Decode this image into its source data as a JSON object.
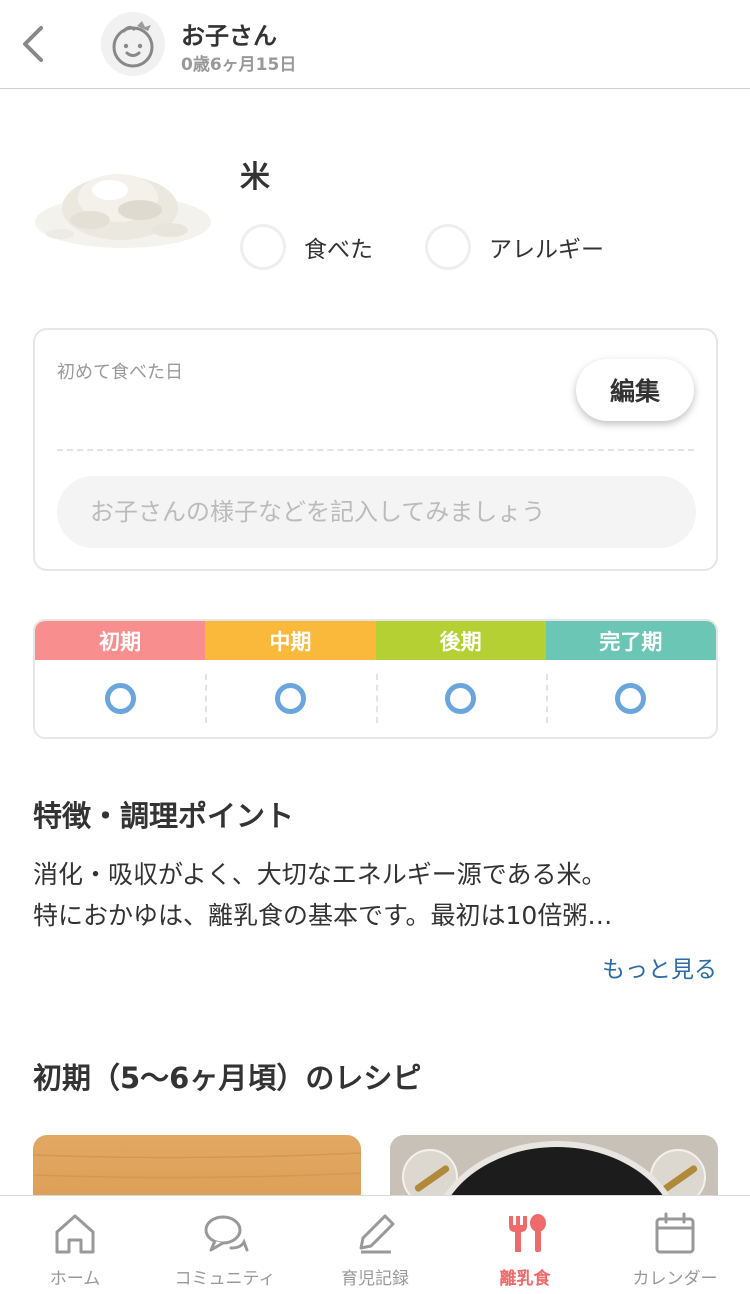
{
  "header": {
    "child_name": "お子さん",
    "child_age": "0歳6ヶ月15日"
  },
  "food": {
    "name": "米",
    "eaten_label": "食べた",
    "allergy_label": "アレルギー",
    "eaten_checked": false,
    "allergy_checked": false
  },
  "first_eaten": {
    "title": "初めて食べた日",
    "edit_label": "編集",
    "memo_value": "",
    "memo_placeholder": "お子さんの様子などを記入してみましょう"
  },
  "stages": [
    {
      "label": "初期",
      "color": "#f98e8e",
      "mark": "○"
    },
    {
      "label": "中期",
      "color": "#fbb93b",
      "mark": "○"
    },
    {
      "label": "後期",
      "color": "#b5d033",
      "mark": "○"
    },
    {
      "label": "完了期",
      "color": "#6cc6b6",
      "mark": "○"
    }
  ],
  "feature": {
    "title": "特徴・調理ポイント",
    "line1": "消化・吸収がよく、大切なエネルギー源である米。",
    "line2": "特におかゆは、離乳食の基本です。最初は10倍粥…",
    "more_label": "もっと見る"
  },
  "recipes": {
    "title": "初期（5〜6ヶ月頃）のレシピ"
  },
  "tabs": [
    {
      "label": "ホーム",
      "icon": "home-icon",
      "active": false
    },
    {
      "label": "コミュニティ",
      "icon": "chat-bubbles-icon",
      "active": false
    },
    {
      "label": "育児記録",
      "icon": "pencil-icon",
      "active": false
    },
    {
      "label": "離乳食",
      "icon": "fork-spoon-icon",
      "active": true
    },
    {
      "label": "カレンダー",
      "icon": "calendar-icon",
      "active": false
    }
  ],
  "colors": {
    "accent": "#ef6b6b",
    "link": "#2b6ca8",
    "stage_mark": "#6aa5dd"
  }
}
